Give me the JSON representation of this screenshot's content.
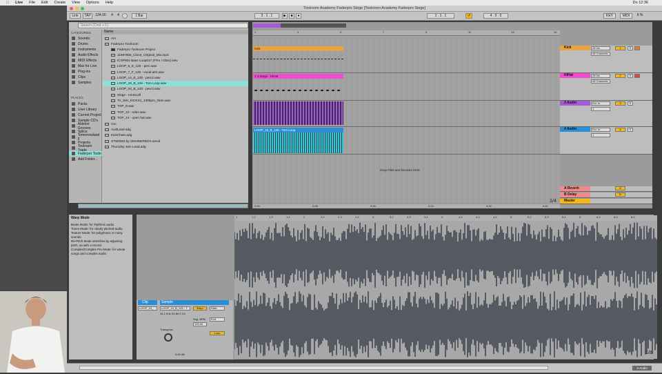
{
  "menubar": {
    "apple": "",
    "app": "Live",
    "items": [
      "File",
      "Edit",
      "Create",
      "View",
      "Options",
      "Help"
    ],
    "clock": "Do 12:36"
  },
  "window": {
    "title": "Toolroom Academy Faderpro Siege  [Toolroom Academy Faderpro Siege]"
  },
  "transport": {
    "link": "Link",
    "tap": "TAP",
    "tempo": "124.00",
    "sig_num": "4",
    "sig_den": "4",
    "metro": "1 Bar",
    "pos": "3 . 1 . 1",
    "loop_start": "1 . 1 . 1",
    "loop_len": "4 . 0 . 0",
    "key": "KEY",
    "midi": "MIDI",
    "cpu": "6 %"
  },
  "browser": {
    "search_placeholder": "Search (Cmd + F)",
    "categories_title": "CATEGORIES",
    "categories": [
      "Sounds",
      "Drums",
      "Instruments",
      "Audio Effects",
      "MIDI Effects",
      "Max for Live",
      "Plug-ins",
      "Clips",
      "Samples"
    ],
    "places_title": "PLACES",
    "places": [
      "Packs",
      "User Library",
      "Current Project",
      "Sample CD's",
      "Ableton Grooves",
      "Splice",
      "Tomorrowland F",
      "Projects",
      "Toolroom Trade",
      "Faderpro Toolrc",
      "Add Folder..."
    ],
    "name_header": "Name",
    "files": [
      "Am",
      "Faderpro Toolroom",
      "Faderpro Toolroom Project",
      "11587955_Clone_Original_Mix.mp3",
      "ICSP004 Bass Loop017 (F#m / Gbm).wav",
      "LOOP_5_E_125 - perc.wav",
      "LOOP_7_F_125 - vocal atm.wav",
      "LOOP_14_E_125 - perc2.wav",
      "LOOP_19_B_125 - Tom Loop.wav",
      "LOOP_24_B_125 - perc3.wav",
      "Siege - HiHat.alf",
      "TA_WH_KICKS1_130bpm_Gbm.wav",
      "TOP_8.wav",
      "TOP_10 - rides.wav",
      "TOP_14 - open hat.wav",
      "Gm",
      "AcidLead.adg",
      "KickChain.adg",
      "STWID84 by SKINNERBOX.amxd",
      "Thursday Jam Lead.adg"
    ]
  },
  "arrangement": {
    "ruler": [
      "1",
      "3",
      "5",
      "7",
      "9",
      "11",
      "13",
      "15"
    ],
    "clips": [
      {
        "name": "Kick",
        "color": "#e9a441"
      },
      {
        "name": "1 3.Siege - HiHat",
        "color": "#f04cd0"
      },
      {
        "name": "",
        "color": "#a35bd6"
      },
      {
        "name": "LOOP_19_B_125 - Tom Loop",
        "color": "#2a8fd6"
      }
    ],
    "drop_text": "Drop Files and Devices Here",
    "time_ruler": [
      "0:00",
      "0:08",
      "0:16",
      "0:24",
      "0:32",
      "0:40"
    ],
    "zoom": "1/4"
  },
  "tracks": [
    {
      "name": "Kick",
      "color": "#e9a441",
      "input": "All Ins",
      "chan": "All Channels",
      "num": "1",
      "sends": "S"
    },
    {
      "name": "HiHat",
      "color": "#f04cd0",
      "input": "All Ins",
      "chan": "All Channels",
      "num": "2",
      "sends": "S"
    },
    {
      "name": "3 Audio",
      "color": "#a35bd6",
      "input": "Ext. In",
      "chan": "1",
      "num": "3",
      "sends": "S"
    },
    {
      "name": "4 Audio",
      "color": "#2a8fd6",
      "input": "Ext. In",
      "chan": "1",
      "num": "4",
      "sends": "S"
    }
  ],
  "returns": [
    {
      "name": "A Reverb",
      "letter": "A",
      "color": "#f08a8a"
    },
    {
      "name": "B Delay",
      "letter": "B",
      "color": "#f08a8a"
    },
    {
      "name": "Master",
      "letter": "",
      "color": "#f5b81b"
    }
  ],
  "info": {
    "title": "Warp Mode",
    "lines": [
      "Beats Mode: for rhythmic audio",
      "Tones Mode: for clearly pitched audio",
      "Texture Mode: for polyphonic or noisy sounds",
      "Re-Pitch Mode stretches by adjusting pitch, as with a record.",
      "Complex/Complex Pro Mode: for whole songs and complex audio"
    ]
  },
  "clipview": {
    "clip": "Clip",
    "clip_name": "LOOP_19_",
    "sample": "Sample",
    "sample_name": "LOOP_19_B_125 - T",
    "sample_info": "44.1 kHz 24 Bit 2 Ch",
    "warp": "Warp",
    "start": "Start",
    "end": "End",
    "loop": "Loop",
    "seg_bpm": "Seg. BPM",
    "bpm": "125.00",
    "transpose": "Transpose",
    "volume": "0.00 dB",
    "zoom": "1/8"
  },
  "waveform": {
    "ruler": [
      "1",
      "1.2",
      "1.3",
      "1.4",
      "2",
      "2.2",
      "2.3",
      "2.4",
      "3",
      "3.2",
      "3.3",
      "3.4",
      "4",
      "4.2",
      "4.3",
      "4.4",
      "5",
      "5.2",
      "5.3",
      "5.4",
      "6",
      "6.2",
      "6.3",
      "6.4"
    ]
  },
  "status": {
    "track": "4-Audio"
  }
}
